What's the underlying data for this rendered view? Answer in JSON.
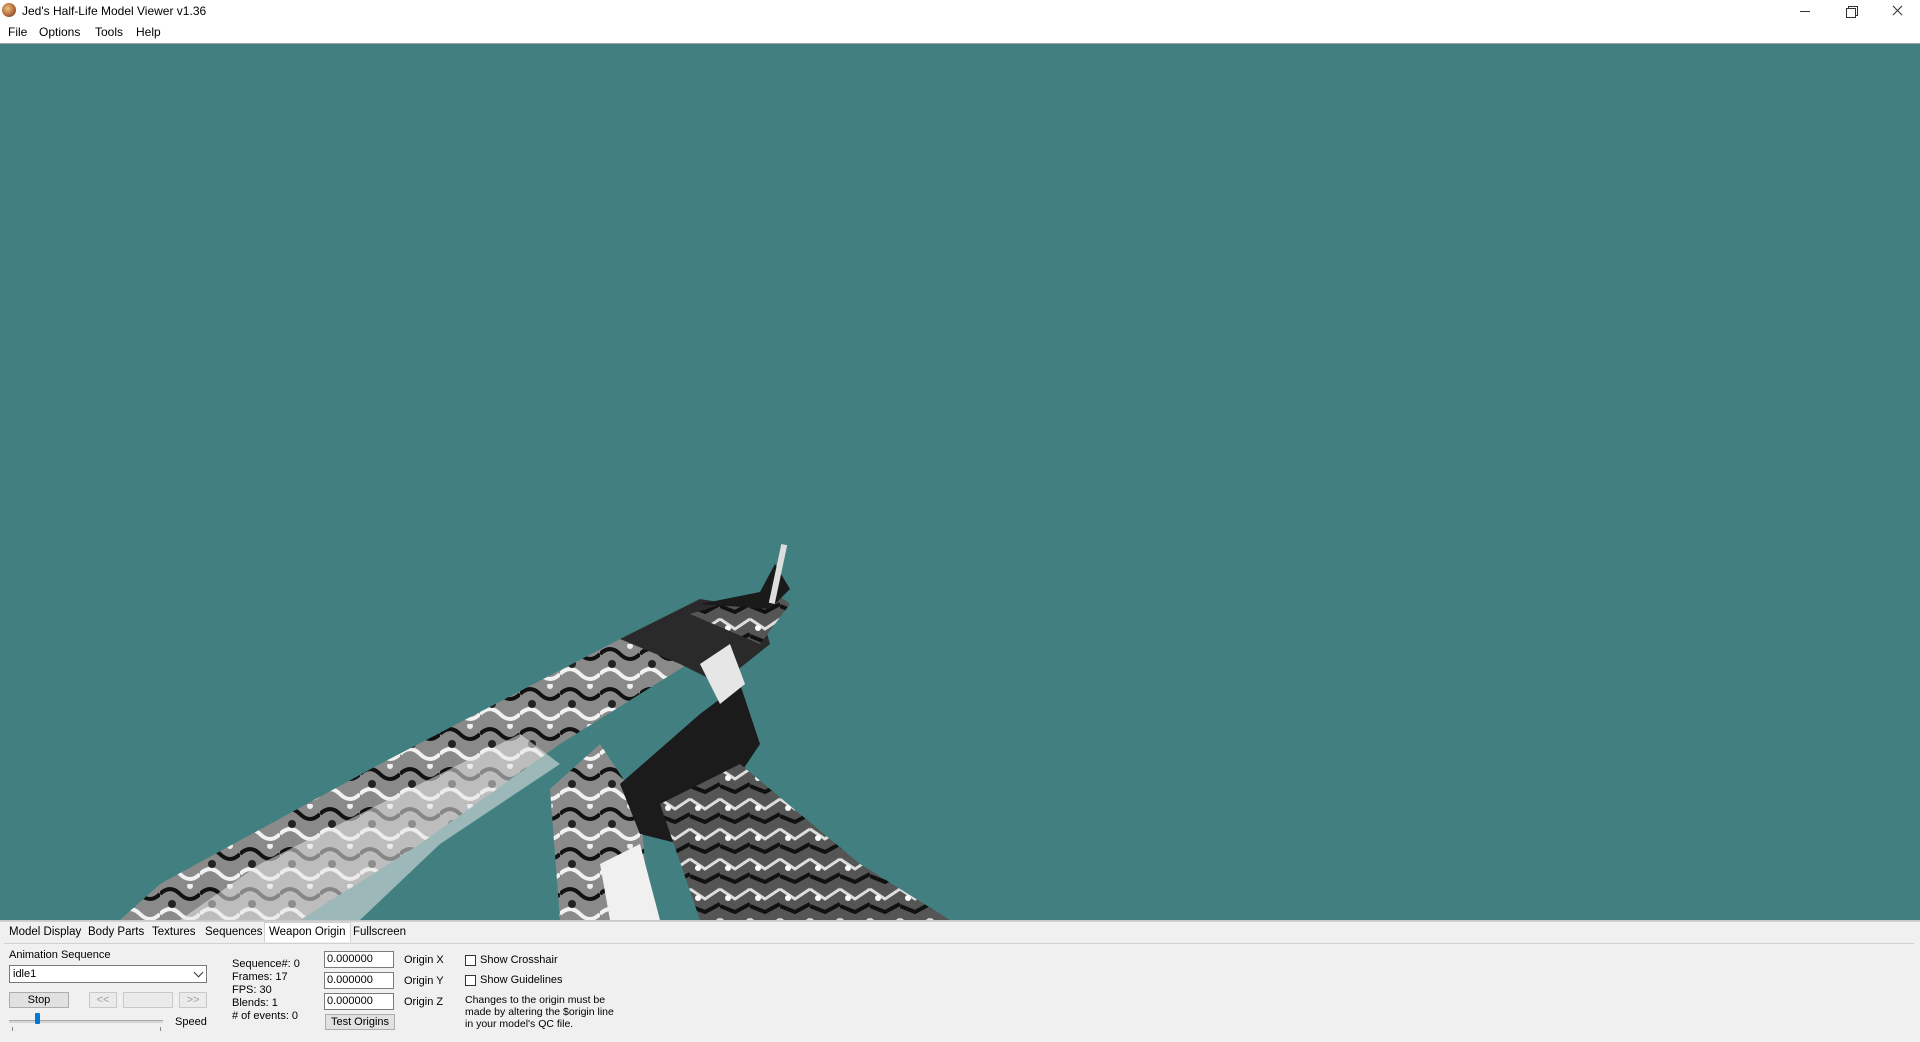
{
  "window": {
    "title": "Jed's Half-Life Model Viewer v1.36",
    "minimize_icon": "minimize-icon",
    "maximize_icon": "restore-icon",
    "close_icon": "close-icon"
  },
  "menu": [
    "File",
    "Options",
    "Tools",
    "Help"
  ],
  "viewport": {
    "background_color": "#417f80",
    "content": "first-person weapon model (rifle held by gloved hands)"
  },
  "tabs": [
    {
      "label": "Model Display",
      "active": false
    },
    {
      "label": "Body Parts",
      "active": false
    },
    {
      "label": "Textures",
      "active": false
    },
    {
      "label": "Sequences",
      "active": false
    },
    {
      "label": "Weapon Origin",
      "active": true
    },
    {
      "label": "Fullscreen",
      "active": false
    }
  ],
  "animation": {
    "label": "Animation Sequence",
    "selected": "idle1",
    "stop_label": "Stop",
    "prev_label": "<<",
    "next_label": ">>",
    "speed_label": "Speed",
    "speed_level": 0.18
  },
  "sequence_info": {
    "sequence": "Sequence#: 0",
    "frames": "Frames: 17",
    "fps": "FPS: 30",
    "blends": "Blends: 1",
    "events": "# of events: 0"
  },
  "origin": {
    "x_value": "0.000000",
    "x_label": "Origin X",
    "y_value": "0.000000",
    "y_label": "Origin Y",
    "z_value": "0.000000",
    "z_label": "Origin Z",
    "test_label": "Test Origins"
  },
  "options": {
    "crosshair_label": "Show Crosshair",
    "crosshair_checked": false,
    "guidelines_label": "Show Guidelines",
    "guidelines_checked": false,
    "note_line1": "Changes to the origin must be",
    "note_line2": "made by altering the $origin line",
    "note_line3": "in your model's QC file."
  }
}
